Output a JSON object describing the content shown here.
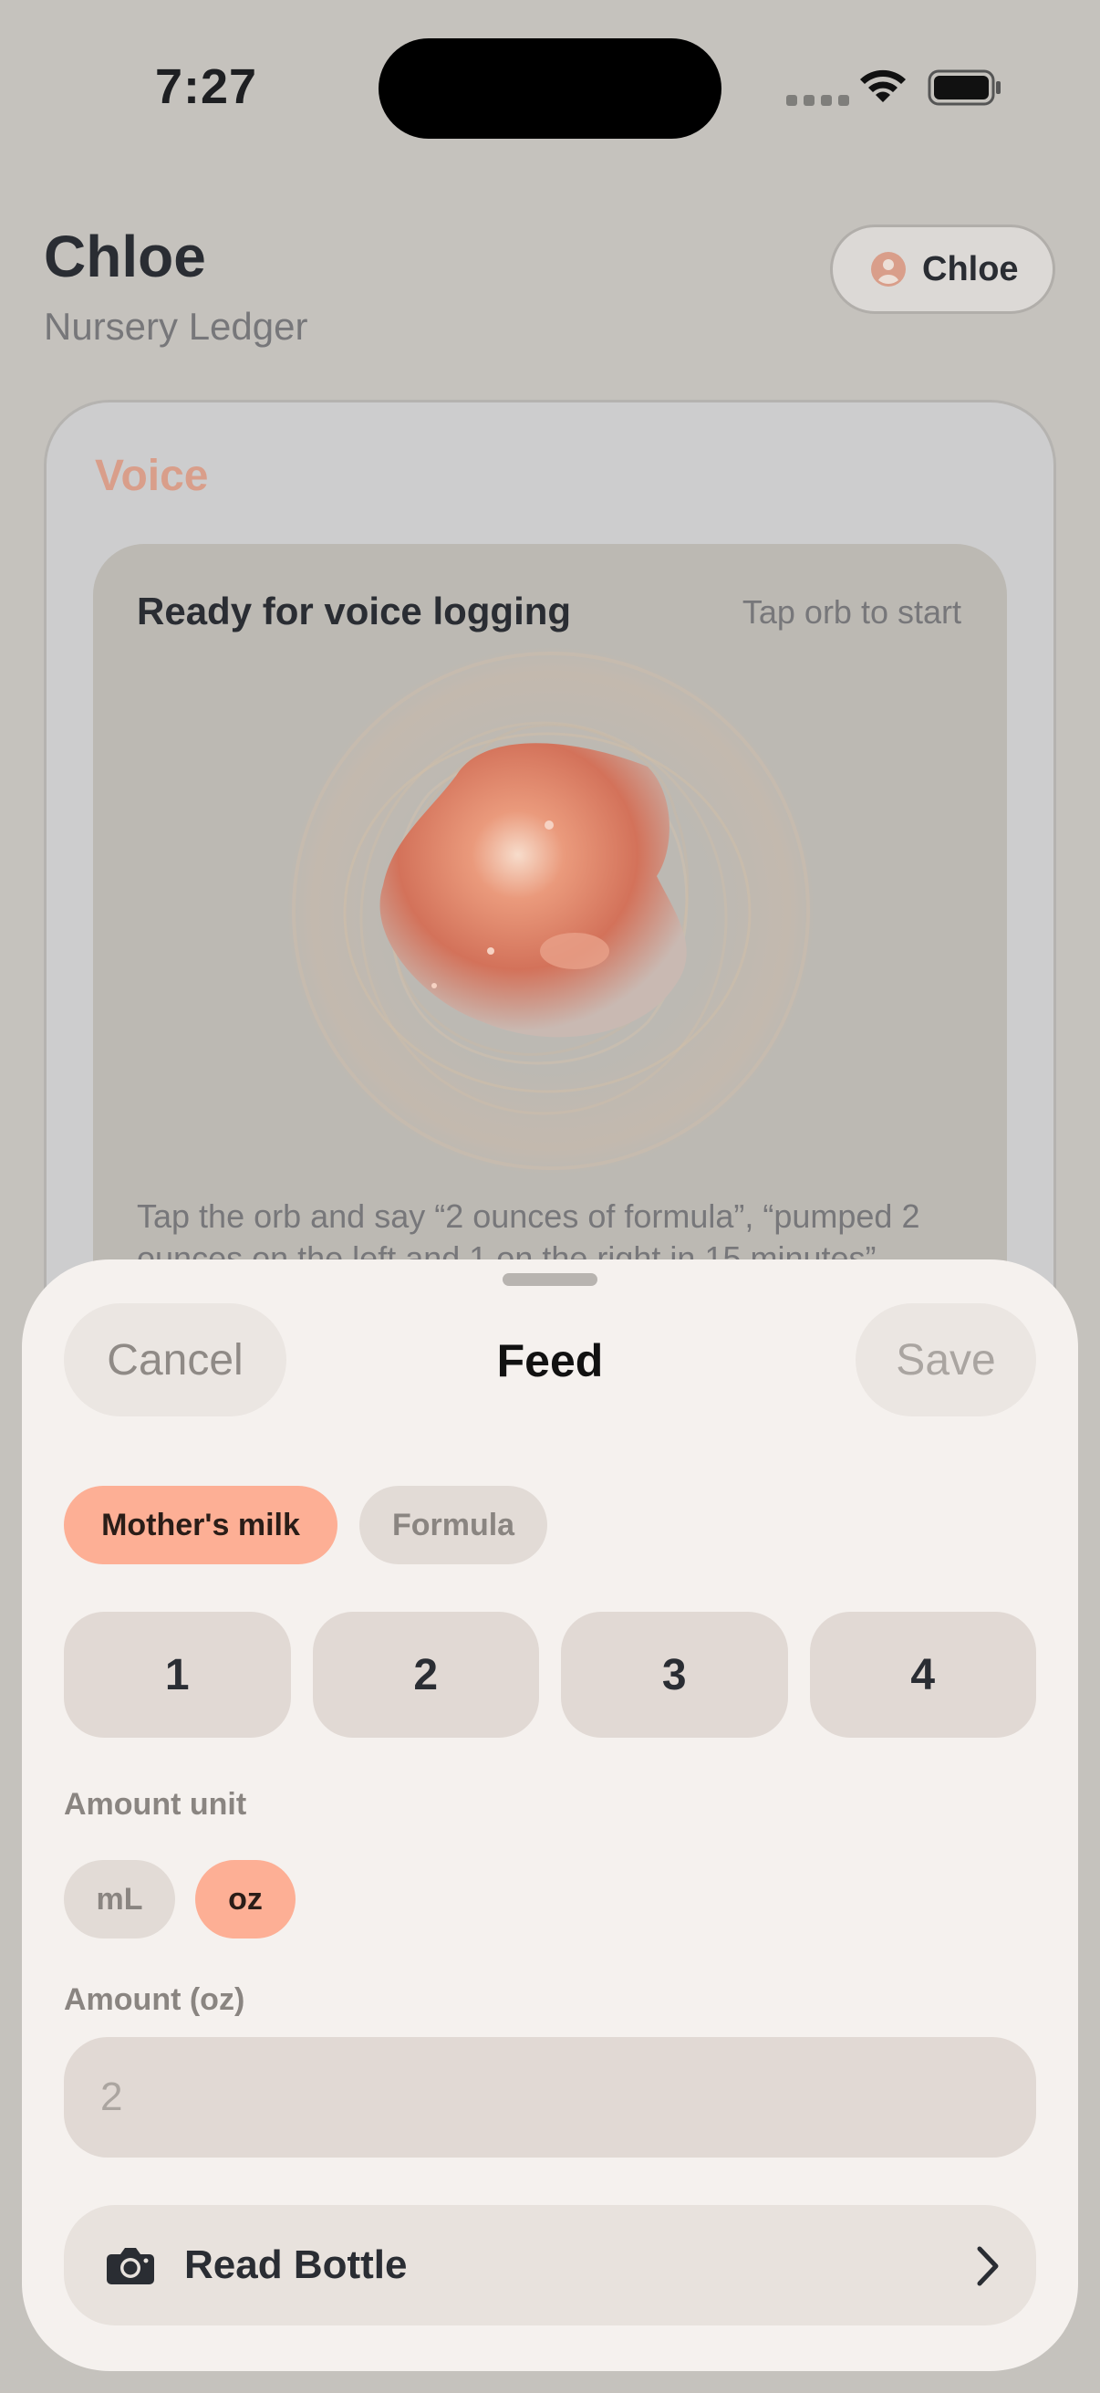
{
  "status_bar": {
    "time": "7:27",
    "icons": [
      "cellular-signal-icon",
      "wifi-icon",
      "battery-icon"
    ]
  },
  "header": {
    "baby_name": "Chloe",
    "subtitle": "Nursery Ledger",
    "profile_label": "Chloe",
    "profile_icon": "person-circle-icon"
  },
  "voice": {
    "section_title": "Voice",
    "status": "Ready for voice logging",
    "hint": "Tap orb to start",
    "instructions": "Tap the orb and say “2 ounces of formula”, “pumped 2 ounces on the left and 1 on the right in 15 minutes”"
  },
  "sheet": {
    "title": "Feed",
    "cancel_label": "Cancel",
    "save_label": "Save",
    "feed_types": [
      {
        "label": "Mother's milk",
        "selected": true
      },
      {
        "label": "Formula",
        "selected": false
      }
    ],
    "quick_amounts": [
      "1",
      "2",
      "3",
      "4"
    ],
    "unit_label": "Amount unit",
    "units": [
      {
        "label": "mL",
        "selected": false
      },
      {
        "label": "oz",
        "selected": true
      }
    ],
    "amount_label": "Amount (oz)",
    "amount_placeholder": "2",
    "read_bottle_label": "Read Bottle",
    "read_bottle_icon": "camera-icon"
  },
  "colors": {
    "accent": "#fdaf95",
    "voice_title": "#d99e8a",
    "sheet_background": "#f5f1ee"
  }
}
